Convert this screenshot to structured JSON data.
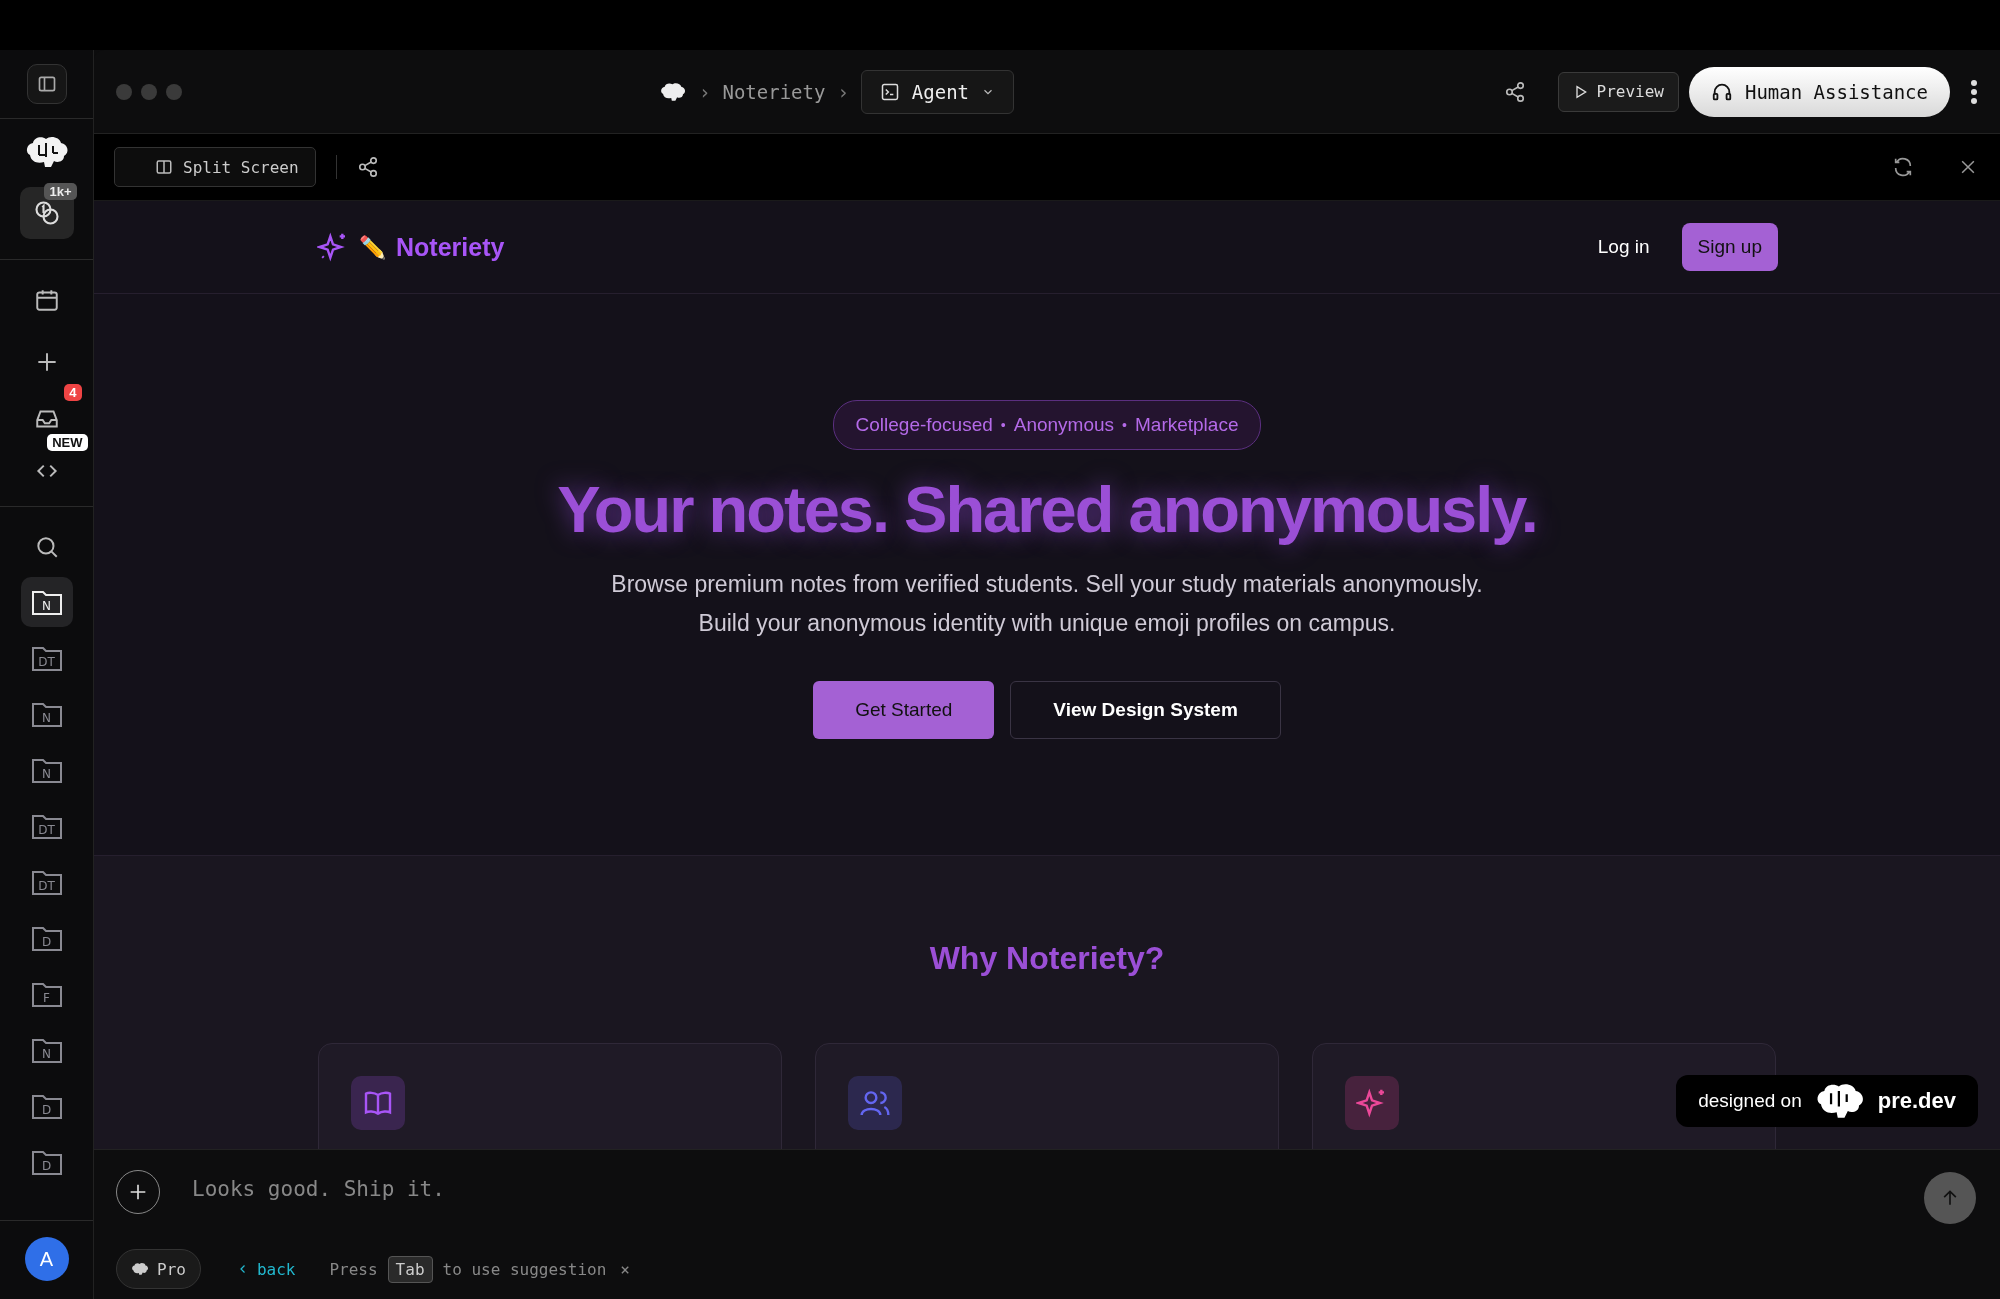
{
  "sidebar": {
    "credits_badge": "1k+",
    "inbox_badge": "4",
    "code_badge": "NEW",
    "folders": [
      {
        "label": "N",
        "selected": true
      },
      {
        "label": "DT",
        "selected": false
      },
      {
        "label": "N",
        "selected": false
      },
      {
        "label": "N",
        "selected": false
      },
      {
        "label": "DT",
        "selected": false
      },
      {
        "label": "DT",
        "selected": false
      },
      {
        "label": "D",
        "selected": false
      },
      {
        "label": "F",
        "selected": false
      },
      {
        "label": "N",
        "selected": false
      },
      {
        "label": "D",
        "selected": false
      },
      {
        "label": "D",
        "selected": false
      }
    ],
    "avatar": "A"
  },
  "topbar": {
    "separator": "›",
    "project": "Noteriety",
    "mode": "Agent",
    "preview": "Preview",
    "assistance": "Human Assistance"
  },
  "subbar": {
    "split_screen": "Split Screen"
  },
  "site": {
    "brand": {
      "emoji": "✏️",
      "name": "Noteriety"
    },
    "nav": {
      "login": "Log in",
      "signup": "Sign up"
    },
    "hero": {
      "tags": [
        "College-focused",
        "Anonymous",
        "Marketplace"
      ],
      "tag_separator": "•",
      "title": "Your notes. Shared anonymously.",
      "description": "Browse premium notes from verified students. Sell your study materials anonymously. Build your anonymous identity with unique emoji profiles on campus.",
      "primary": "Get Started",
      "secondary": "View Design System"
    },
    "features": {
      "title": "Why Noteriety?",
      "cards": [
        {
          "kind": "book",
          "color": "#a855f7"
        },
        {
          "kind": "users",
          "color": "#6366f1"
        },
        {
          "kind": "sparkles",
          "color": "#ec4899"
        }
      ]
    }
  },
  "badge": {
    "prefix": "designed on",
    "brand": "pre.dev"
  },
  "composer": {
    "placeholder": "Looks good. Ship it.",
    "model": "Pro",
    "back": "back",
    "hint": {
      "before": "Press",
      "key": "Tab",
      "after": "to use suggestion",
      "dismiss": "×"
    }
  }
}
